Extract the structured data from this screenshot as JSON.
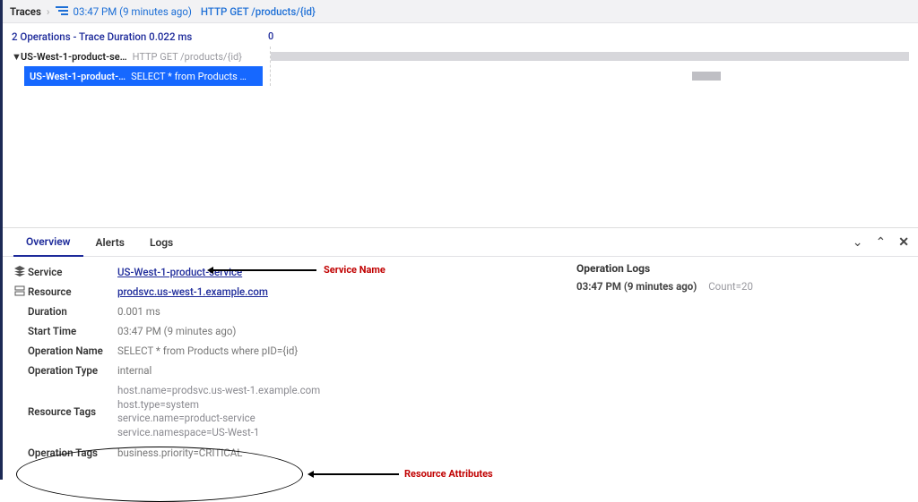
{
  "breadcrumb": {
    "root": "Traces",
    "time": "03:47 PM  (9 minutes ago)",
    "endpoint": "HTTP GET /products/{id}"
  },
  "trace": {
    "summary": "2 Operations - Trace Duration 0.022 ms",
    "zero": "0",
    "root": {
      "service": "US-West-1-product-se…",
      "op": "HTTP GET /products/{id}"
    },
    "child": {
      "service": "US-West-1-product-…",
      "op": "SELECT * from Products …"
    }
  },
  "tabs": {
    "overview": "Overview",
    "alerts": "Alerts",
    "logs": "Logs"
  },
  "details": {
    "service_label": "Service",
    "service_value": "US-West-1-product-service",
    "resource_label": "Resource",
    "resource_value": "prodsvc.us-west-1.example.com",
    "duration_label": "Duration",
    "duration_value": "0.001 ms",
    "start_label": "Start Time",
    "start_value": "03:47 PM  (9 minutes ago)",
    "opname_label": "Operation Name",
    "opname_value": "SELECT * from Products where pID={id}",
    "optype_label": "Operation Type",
    "optype_value": "internal",
    "rtags_label": "Resource Tags",
    "rtags_value": "host.name=prodsvc.us-west-1.example.com\nhost.type=system\nservice.name=product-service\nservice.namespace=US-West-1",
    "otags_label": "Operation Tags",
    "otags_value": "business.priority=CRITICAL"
  },
  "annotations": {
    "service_name": "Service Name",
    "resource_attrs": "Resource Attributes"
  },
  "oplogs": {
    "title": "Operation Logs",
    "time": "03:47 PM  (9 minutes ago)",
    "count": "Count=20"
  }
}
